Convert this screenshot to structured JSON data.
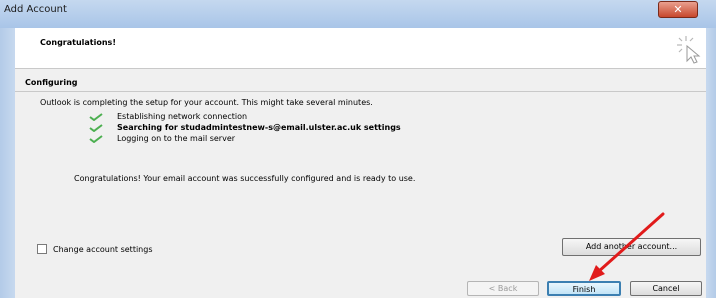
{
  "window": {
    "title": "Add Account",
    "close_glyph": "✕"
  },
  "header": {
    "title": "Congratulations!",
    "icon": "cursor-click-icon"
  },
  "section": {
    "title": "Configuring"
  },
  "intro": "Outlook is completing the setup for your account. This might take several minutes.",
  "steps": [
    {
      "label": "Establishing network connection",
      "status": "done",
      "bold": false
    },
    {
      "label": "Searching for studadmintestnew-s@email.ulster.ac.uk settings",
      "status": "done",
      "bold": true
    },
    {
      "label": "Logging on to the mail server",
      "status": "done",
      "bold": false
    }
  ],
  "message": "Congratulations! Your email account was successfully configured and is ready to use.",
  "change_settings": {
    "label": "Change account settings",
    "checked": false
  },
  "buttons": {
    "add_another": "Add another account...",
    "back": "< Back",
    "finish": "Finish",
    "cancel": "Cancel"
  },
  "colors": {
    "check": "#4caf50",
    "annotation_arrow": "#e11b1b",
    "titlebar": "#b9d1ea"
  }
}
